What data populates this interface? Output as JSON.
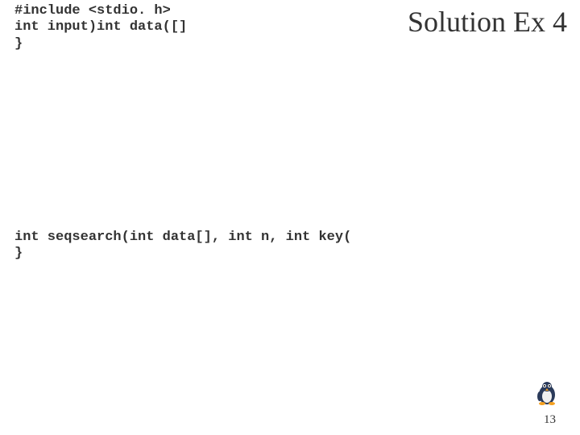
{
  "title": "Solution Ex 4",
  "code_top": {
    "line1": "#include <stdio. h>",
    "line2": "int input)int data([]",
    "line3": "}"
  },
  "code_mid": {
    "line1": "int seqsearch(int data[], int n, int key(",
    "line2": "}"
  },
  "page_number": "13"
}
